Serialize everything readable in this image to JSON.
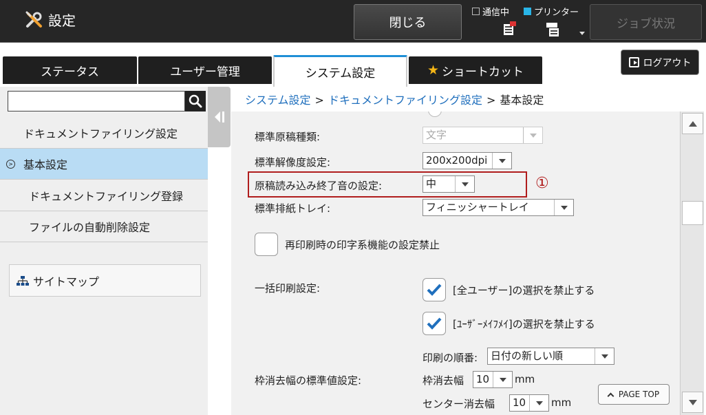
{
  "header": {
    "title": "設定",
    "close_label": "閉じる",
    "status_communicating": "通信中",
    "status_printer": "プリンター",
    "job_status_label": "ジョブ状況",
    "accent_color": "#29b5e8"
  },
  "tabs": [
    {
      "label": "ステータス"
    },
    {
      "label": "ユーザー管理"
    },
    {
      "label": "システム設定",
      "active": true
    },
    {
      "label": "ショートカット"
    }
  ],
  "logout_label": "ログアウト",
  "sidebar": {
    "search_value": "",
    "items": [
      {
        "label": "ドキュメントファイリング設定"
      },
      {
        "label": "基本設定",
        "active": true
      },
      {
        "label": "ドキュメントファイリング登録"
      },
      {
        "label": "ファイルの自動削除設定"
      }
    ],
    "sitemap_label": "サイトマップ"
  },
  "breadcrumb": {
    "items": [
      "システム設定",
      "ドキュメントファイリング設定"
    ],
    "current": "基本設定",
    "sep": ">"
  },
  "settings": {
    "doc_type": {
      "label": "標準原稿種類:",
      "value": "文字"
    },
    "resolution": {
      "label": "標準解像度設定:",
      "value": "200x200dpi"
    },
    "scan_end_sound": {
      "label": "原稿読み込み終了音の設定:",
      "value": "中"
    },
    "output_tray": {
      "label": "標準排紙トレイ:",
      "value": "フィニッシャートレイ"
    },
    "reprint_disable": {
      "label": "再印刷時の印字系機能の設定禁止",
      "checked": false
    },
    "batch_print": {
      "label": "一括印刷設定:",
      "opt_all_users": {
        "label": "[全ユーザー]の選択を禁止する",
        "checked": true
      },
      "opt_user_unknown": {
        "label": "[ﾕｰｻﾞｰﾒｲﾌﾒｲ]の選択を禁止する",
        "checked": true
      },
      "order_label": "印刷の順番:",
      "order_value": "日付の新しい順"
    },
    "edge_erase": {
      "label": "枠消去幅の標準値設定:",
      "frame_label": "枠消去幅",
      "frame_value": "10",
      "center_label": "センター消去幅",
      "center_value": "10",
      "unit": "mm"
    }
  },
  "callout_number": "①",
  "page_top_label": "PAGE TOP"
}
